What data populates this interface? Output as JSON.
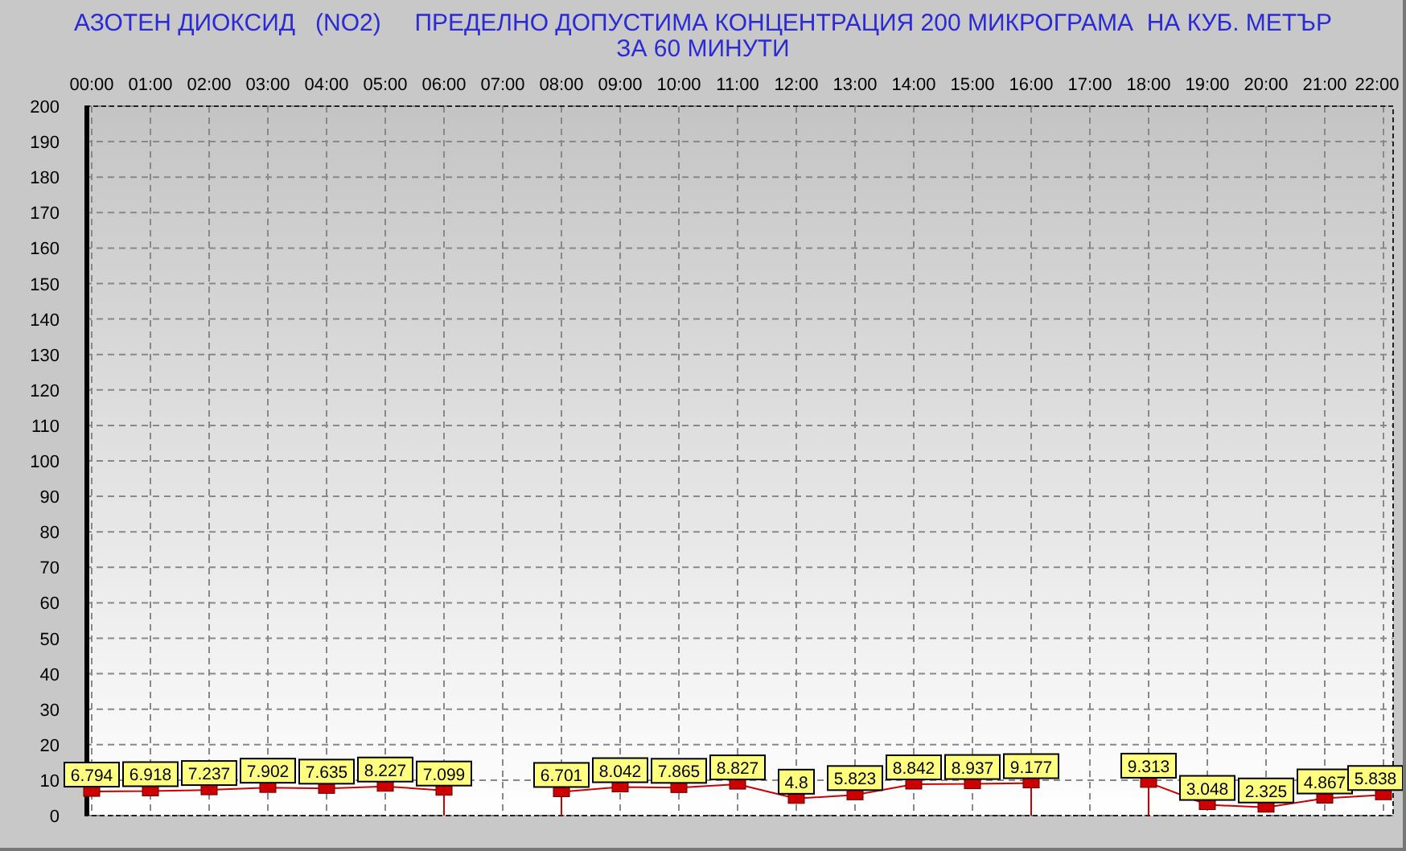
{
  "chart_data": {
    "type": "line",
    "title": "АЗОТЕН ДИОКСИД   (NO2)     ПРЕДЕЛНО ДОПУСТИМА КОНЦЕНТРАЦИЯ 200 МИКРОГРАМА  НА КУБ. МЕТЪР\nЗА 60 МИНУТИ",
    "categories": [
      "00:00",
      "01:00",
      "02:00",
      "03:00",
      "04:00",
      "05:00",
      "06:00",
      "07:00",
      "08:00",
      "09:00",
      "10:00",
      "11:00",
      "12:00",
      "13:00",
      "14:00",
      "15:00",
      "16:00",
      "17:00",
      "18:00",
      "19:00",
      "20:00",
      "21:00",
      "22:00"
    ],
    "series": [
      {
        "color": "#cc0000",
        "marker": "square",
        "values": [
          6.794,
          6.918,
          7.237,
          7.902,
          7.635,
          8.227,
          7.099,
          null,
          6.701,
          8.042,
          7.865,
          8.827,
          4.8,
          5.823,
          8.842,
          8.937,
          9.177,
          null,
          9.313,
          3.048,
          2.325,
          4.867,
          5.838
        ]
      }
    ],
    "ylim": [
      0,
      200
    ],
    "yticks": [
      0,
      10,
      20,
      30,
      40,
      50,
      60,
      70,
      80,
      90,
      100,
      110,
      120,
      130,
      140,
      150,
      160,
      170,
      180,
      190,
      200
    ],
    "grid": true,
    "data_labels": true
  }
}
